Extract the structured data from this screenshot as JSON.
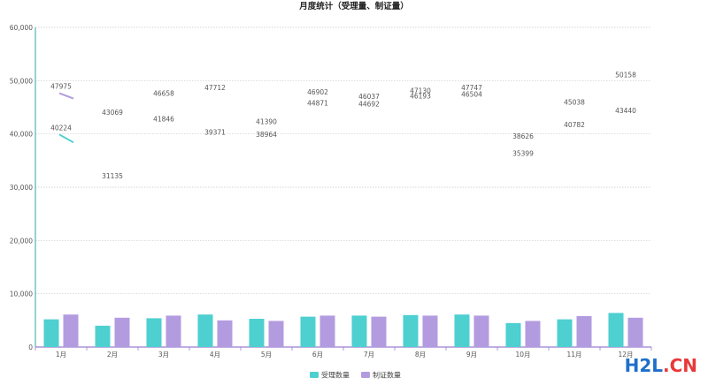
{
  "chart_data": {
    "type": "bar",
    "title": "月度统计（受理量、制证量）",
    "categories": [
      "1月",
      "2月",
      "3月",
      "4月",
      "5月",
      "6月",
      "7月",
      "8月",
      "9月",
      "10月",
      "11月",
      "12月"
    ],
    "ylim": [
      0,
      60000
    ],
    "yticks": [
      "0",
      "10,000",
      "20,000",
      "30,000",
      "40,000",
      "50,000",
      "60,000"
    ],
    "ytick_values": [
      0,
      10000,
      20000,
      30000,
      40000,
      50000,
      60000
    ],
    "grid": true,
    "legend_position": "bottom-center",
    "series": [
      {
        "name": "受理数量",
        "color": "#4ecfd0",
        "bar_values": [
          5200,
          4000,
          5400,
          6100,
          5300,
          5700,
          5900,
          6000,
          6100,
          4500,
          5200,
          6400
        ],
        "line_values": [
          40224,
          31135,
          41846,
          39371,
          38964,
          44871,
          44692,
          46193,
          46504,
          35399,
          40782,
          43440
        ]
      },
      {
        "name": "制证数量",
        "color": "#b39be0",
        "bar_values": [
          6100,
          5500,
          5900,
          5000,
          4900,
          5900,
          5700,
          5900,
          5900,
          4900,
          5800,
          5500
        ],
        "line_values": [
          47975,
          43069,
          46658,
          47712,
          41390,
          46902,
          46037,
          47130,
          47747,
          38626,
          45038,
          50158
        ]
      }
    ]
  },
  "watermark": {
    "part1": "H2L",
    "part2": ".CN"
  }
}
